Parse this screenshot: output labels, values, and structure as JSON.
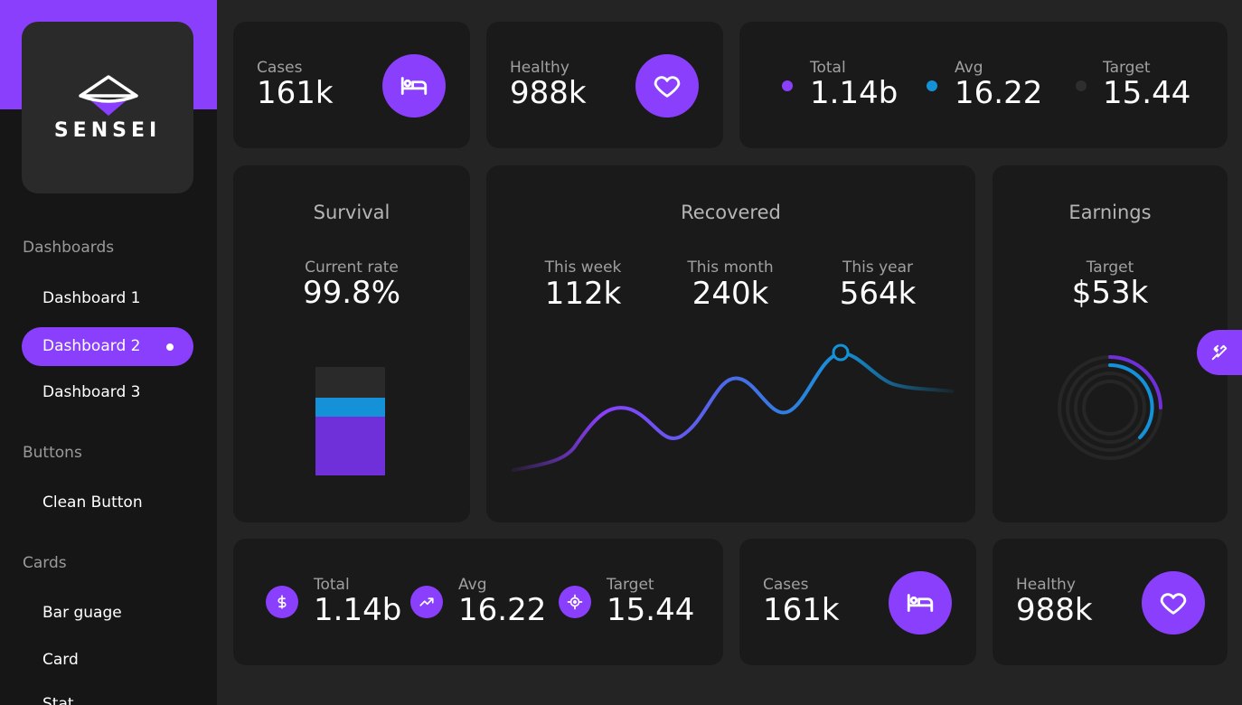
{
  "app": {
    "logo_text": "SENSEI",
    "accent_color": "#8a3ffc",
    "secondary_color": "#1591d8"
  },
  "sidebar": {
    "sections": [
      {
        "title": "Dashboards",
        "items": [
          "Dashboard 1",
          "Dashboard 2",
          "Dashboard 3"
        ]
      },
      {
        "title": "Buttons",
        "items": [
          "Clean Button"
        ]
      },
      {
        "title": "Cards",
        "items": [
          "Bar guage",
          "Card",
          "Stat..."
        ]
      }
    ],
    "active_item": "Dashboard 2"
  },
  "top_row": {
    "cases": {
      "label": "Cases",
      "value": "161k",
      "icon": "bed-icon"
    },
    "healthy": {
      "label": "Healthy",
      "value": "988k",
      "icon": "heart-icon"
    },
    "stats": [
      {
        "label": "Total",
        "value": "1.14b",
        "color": "#8a3ffc"
      },
      {
        "label": "Avg",
        "value": "16.22",
        "color": "#1591d8"
      },
      {
        "label": "Target",
        "value": "15.44",
        "color": "#2e2e2e"
      }
    ]
  },
  "survival": {
    "title": "Survival",
    "sub_label": "Current rate",
    "value": "99.8%"
  },
  "recovered": {
    "title": "Recovered",
    "stats": [
      {
        "label": "This week",
        "value": "112k"
      },
      {
        "label": "This month",
        "value": "240k"
      },
      {
        "label": "This year",
        "value": "564k"
      }
    ]
  },
  "earnings": {
    "title": "Earnings",
    "sub_label": "Target",
    "value": "$53k"
  },
  "bottom_row": {
    "stats": [
      {
        "label": "Total",
        "value": "1.14b",
        "icon": "dollar-icon"
      },
      {
        "label": "Avg",
        "value": "16.22",
        "icon": "trending-up-icon"
      },
      {
        "label": "Target",
        "value": "15.44",
        "icon": "target-icon"
      }
    ],
    "cases": {
      "label": "Cases",
      "value": "161k",
      "icon": "bed-icon"
    },
    "healthy": {
      "label": "Healthy",
      "value": "988k",
      "icon": "heart-icon"
    }
  },
  "floating_button": {
    "icon": "tools-icon"
  }
}
